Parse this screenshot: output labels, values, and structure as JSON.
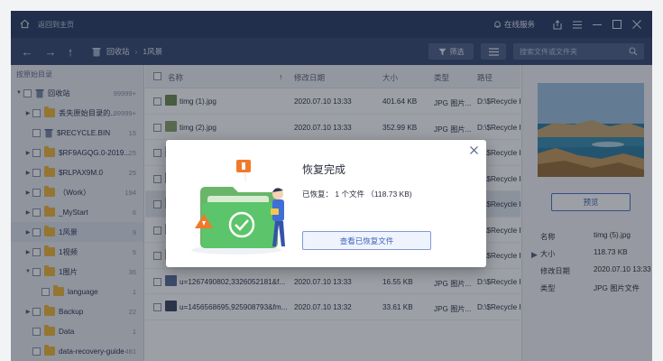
{
  "titlebar": {
    "home_label": "返回到主页",
    "online_service": "在线服务"
  },
  "toolbar": {
    "breadcrumb": [
      "回收站",
      "1风景"
    ],
    "filter_label": "筛选",
    "search_placeholder": "搜索文件或文件夹"
  },
  "sidebar": {
    "heading": "按原始目录",
    "items": [
      {
        "label": "回收站",
        "count": "99999+",
        "arrow": "▼",
        "indent": 0,
        "icon": "recycle-bin-icon"
      },
      {
        "label": "丢失原始目录的...",
        "count": "99999+",
        "arrow": "▶",
        "indent": 1,
        "icon": "folder-icon"
      },
      {
        "label": "$RECYCLE.BIN",
        "count": "15",
        "arrow": "",
        "indent": 1,
        "icon": "recycle-bin-icon"
      },
      {
        "label": "$RF9AGQG.0-2019...",
        "count": "25",
        "arrow": "▶",
        "indent": 1,
        "icon": "folder-icon"
      },
      {
        "label": "$RLPAX9M.0",
        "count": "25",
        "arrow": "▶",
        "indent": 1,
        "icon": "folder-icon"
      },
      {
        "label": "（Work）",
        "count": "194",
        "arrow": "▶",
        "indent": 1,
        "icon": "folder-icon"
      },
      {
        "label": "_MyStart",
        "count": "6",
        "arrow": "▶",
        "indent": 1,
        "icon": "folder-icon"
      },
      {
        "label": "1风景",
        "count": "9",
        "arrow": "▶",
        "indent": 1,
        "icon": "folder-icon",
        "selected": true
      },
      {
        "label": "1视频",
        "count": "5",
        "arrow": "▶",
        "indent": 1,
        "icon": "folder-icon"
      },
      {
        "label": "1图片",
        "count": "36",
        "arrow": "▼",
        "indent": 1,
        "icon": "folder-icon"
      },
      {
        "label": "language",
        "count": "1",
        "arrow": "",
        "indent": 2,
        "icon": "folder-icon"
      },
      {
        "label": "Backup",
        "count": "22",
        "arrow": "▶",
        "indent": 1,
        "icon": "folder-icon"
      },
      {
        "label": "Data",
        "count": "1",
        "arrow": "",
        "indent": 1,
        "icon": "folder-icon"
      },
      {
        "label": "data-recovery-guide",
        "count": "481",
        "arrow": "",
        "indent": 1,
        "icon": "folder-icon"
      }
    ]
  },
  "list": {
    "columns": [
      "名称",
      "修改日期",
      "大小",
      "类型",
      "路径"
    ],
    "rows": [
      {
        "name": "timg (1).jpg",
        "date": "2020.07.10 13:33",
        "size": "401.64 KB",
        "type": "JPG 图片...",
        "path": "D:\\$Recycle B",
        "thumb": "#6d8c52"
      },
      {
        "name": "timg (2).jpg",
        "date": "2020.07.10 13:33",
        "size": "352.99 KB",
        "type": "JPG 图片...",
        "path": "D:\\$Recycle B",
        "thumb": "#8ba26b"
      },
      {
        "name": "",
        "date": "",
        "size": "",
        "type": "",
        "path": "D:\\$Recycle B",
        "thumb": "#9db0c8"
      },
      {
        "name": "",
        "date": "",
        "size": "",
        "type": "",
        "path": "D:\\$Recycle B",
        "thumb": "#7b8fa7"
      },
      {
        "name": "",
        "date": "",
        "size": "",
        "type": "",
        "path": "D:\\$Recycle B",
        "thumb": "#a9b57a",
        "highlight": true
      },
      {
        "name": "",
        "date": "",
        "size": "",
        "type": "",
        "path": "D:\\$Recycle B",
        "thumb": "#8aa5c0"
      },
      {
        "name": "",
        "date": "",
        "size": "",
        "type": "",
        "path": "D:\\$Recycle B",
        "thumb": "#c0a87a"
      },
      {
        "name": "u=1267490802,3326052181&f...",
        "date": "2020.07.10 13:33",
        "size": "16.55 KB",
        "type": "JPG 图片...",
        "path": "D:\\$Recycle B",
        "thumb": "#5c6f9a"
      },
      {
        "name": "u=1456568695,925908793&fm...",
        "date": "2020.07.10 13:32",
        "size": "33.61 KB",
        "type": "JPG 图片...",
        "path": "D:\\$Recycle B",
        "thumb": "#3d4660"
      }
    ]
  },
  "preview": {
    "button_label": "预览",
    "info": [
      {
        "key": "名称",
        "value": "timg (5).jpg"
      },
      {
        "key": "大小",
        "value": "118.73 KB"
      },
      {
        "key": "修改日期",
        "value": "2020.07.10 13:33"
      },
      {
        "key": "类型",
        "value": "JPG 图片文件"
      }
    ]
  },
  "dialog": {
    "title": "恢复完成",
    "summary": "已恢复： 1 个文件 （118.73 KB)",
    "view_button": "查看已恢复文件"
  },
  "colors": {
    "titlebar": "#2c3e66",
    "toolbar": "#3a4b72",
    "accent": "#4f74c9",
    "folder": "#f1b93a",
    "dialog_green": "#5cc46a"
  }
}
